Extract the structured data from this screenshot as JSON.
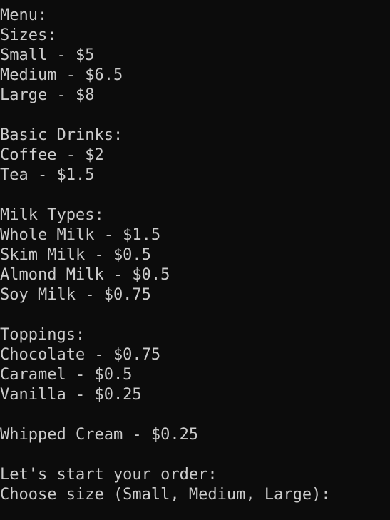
{
  "terminal": {
    "header": {
      "menu": "Menu:",
      "sizes": "Sizes:"
    },
    "sizes": [
      "Small - $5",
      "Medium - $6.5",
      "Large - $8"
    ],
    "basic_drinks": {
      "heading": "Basic Drinks:",
      "items": [
        "Coffee - $2",
        "Tea - $1.5"
      ]
    },
    "milk_types": {
      "heading": "Milk Types:",
      "items": [
        "Whole Milk - $1.5",
        "Skim Milk - $0.5",
        "Almond Milk - $0.5",
        "Soy Milk - $0.75"
      ]
    },
    "toppings": {
      "heading": "Toppings:",
      "items": [
        "Chocolate - $0.75",
        "Caramel - $0.5",
        "Vanilla - $0.25"
      ]
    },
    "whipped_cream": "Whipped Cream - $0.25",
    "order_start": "Let's start your order:",
    "prompt": "Choose size (Small, Medium, Large): "
  }
}
